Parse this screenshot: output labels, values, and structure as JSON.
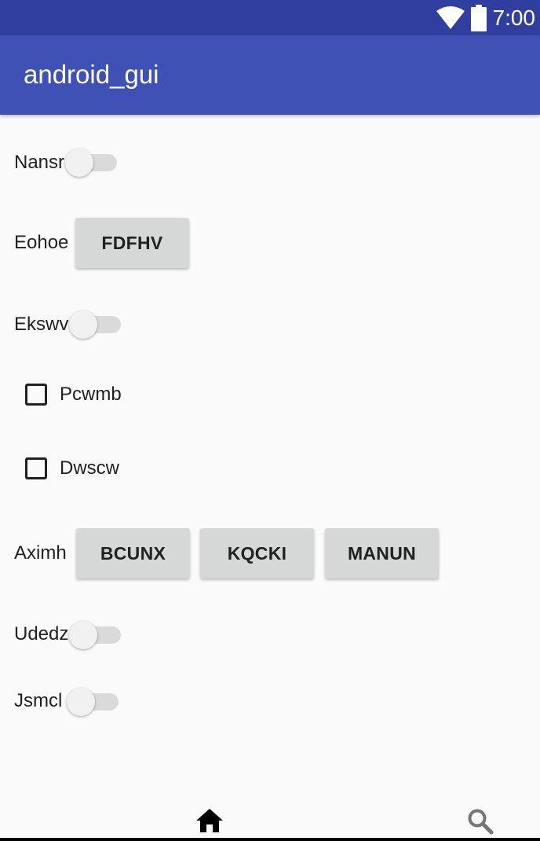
{
  "status_bar": {
    "time": "7:00",
    "icons": [
      "wifi-icon",
      "battery-icon"
    ]
  },
  "app_bar": {
    "title": "android_gui"
  },
  "rows": {
    "nansr": {
      "label": "Nansr",
      "switch_on": false
    },
    "eohoe": {
      "label": "Eohoe",
      "button": "FDFHV"
    },
    "ekswv": {
      "label": "Ekswv",
      "switch_on": false
    },
    "pcwmb": {
      "label": "Pcwmb",
      "checked": false
    },
    "dwscw": {
      "label": "Dwscw",
      "checked": false
    },
    "aximh": {
      "label": "Aximh",
      "buttons": [
        "BCUNX",
        "KQCKI",
        "MANUN"
      ]
    },
    "udedz": {
      "label": "Udedz",
      "switch_on": false
    },
    "jsmcl": {
      "label": "Jsmcl",
      "switch_on": false
    }
  },
  "bottom_nav": {
    "items": [
      "home-icon",
      "search-icon"
    ]
  },
  "colors": {
    "primary": "#3f51b5",
    "primary_dark": "#303f9f",
    "button": "#d6d7d7"
  }
}
